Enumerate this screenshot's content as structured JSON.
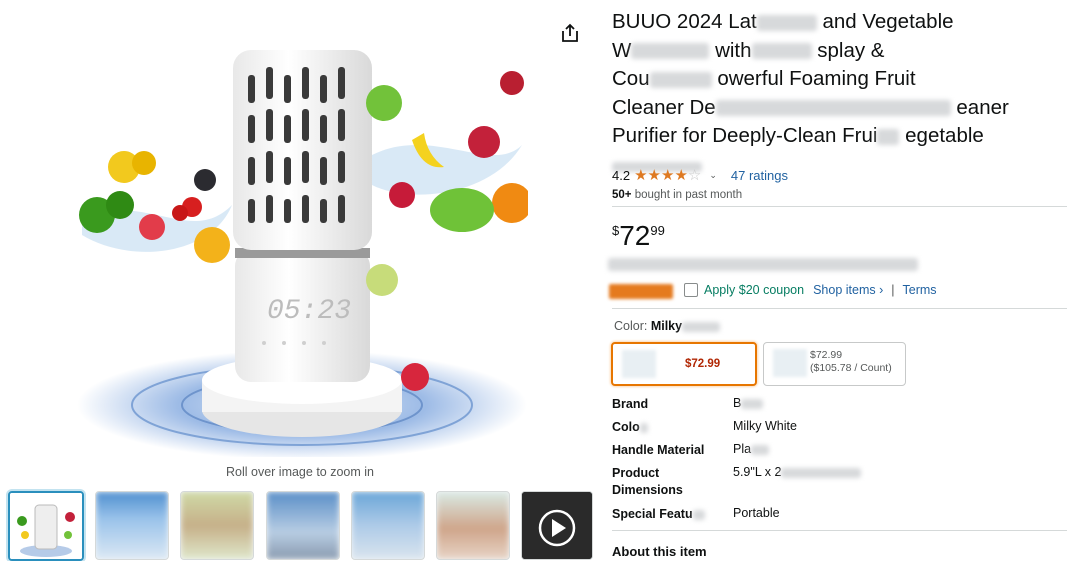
{
  "gallery": {
    "zoom_hint": "Roll over image to zoom in",
    "display_time": "05:23",
    "thumbnail_count": 7
  },
  "product": {
    "title_lines": [
      "BUUO 2024 Lat",
      "W",
      "Cou",
      "Cleaner De",
      "Purifier for Deeply-Clean Frui"
    ],
    "title_tails": [
      "and Vegetable",
      "with",
      "owerful Foaming Fruit",
      "eaner",
      "egetable"
    ],
    "title_mids": [
      "",
      "splay &",
      "",
      "",
      ""
    ]
  },
  "rating": {
    "value": "4.2",
    "stars": "4.2 out of 5 stars",
    "count_label": "47 ratings"
  },
  "purchase": {
    "bought_count": "50+",
    "bought_text": "bought in past month"
  },
  "price": {
    "symbol": "$",
    "whole": "72",
    "fraction": "99"
  },
  "coupon": {
    "label": "Apply $20 coupon",
    "shop_items": "Shop items ›",
    "separator": "|",
    "terms": "Terms"
  },
  "color_selector": {
    "label": "Color:",
    "value": "Milky",
    "options": [
      {
        "price": "$72.99"
      },
      {
        "price": "$72.99",
        "unit_price": "($105.78 / Count)"
      }
    ]
  },
  "specs": [
    {
      "key": "Brand",
      "value": "B"
    },
    {
      "key": "Colo",
      "value": "Milky White"
    },
    {
      "key": "Handle Material",
      "value": "Pla"
    },
    {
      "key": "Product Dimensions",
      "value": "5.9\"L x 2"
    },
    {
      "key": "Special Featu",
      "value": "Portable"
    }
  ],
  "about": {
    "heading": "About this item"
  },
  "colors": {
    "link": "#2162a1",
    "star": "#de7921",
    "deal_price": "#b12704",
    "selected_border": "#e77600",
    "coupon": "#067d62"
  }
}
